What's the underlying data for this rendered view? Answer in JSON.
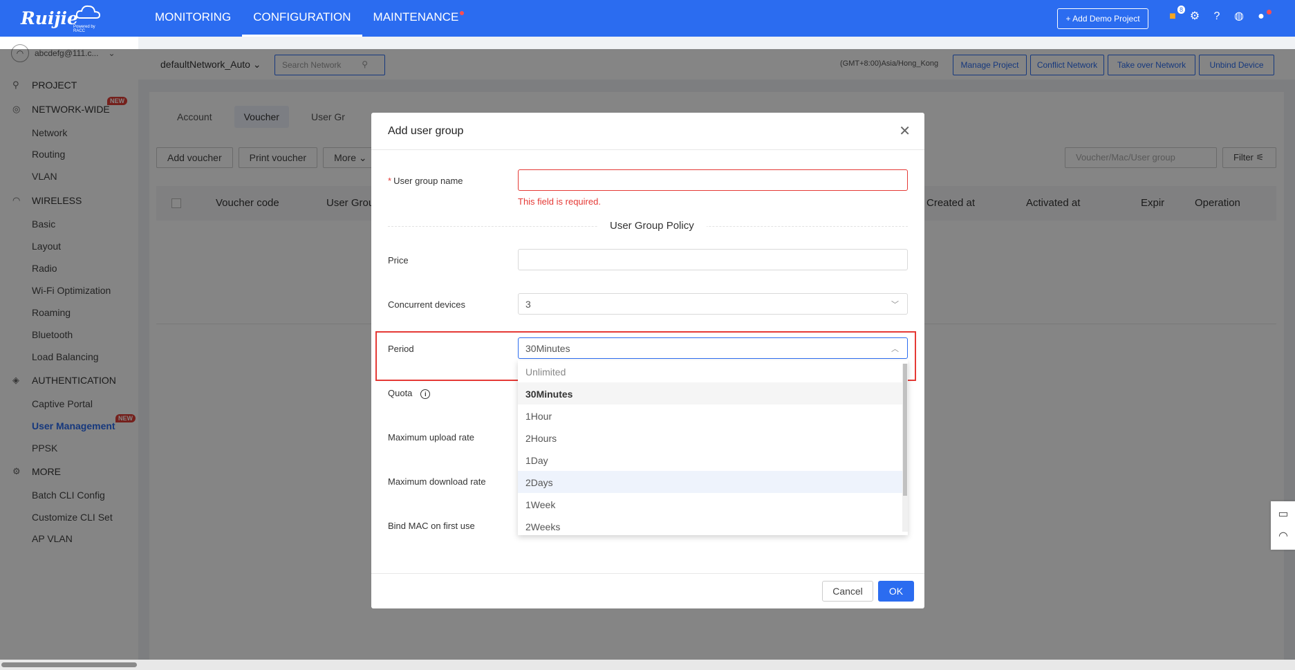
{
  "header": {
    "logo_text": "Ruijie",
    "logo_sub": "Powered by RACC",
    "nav": [
      "MONITORING",
      "CONFIGURATION",
      "MAINTENANCE"
    ],
    "add_demo_label": "+ Add Demo Project",
    "gift_badge": "8"
  },
  "sidebar": {
    "user": "abcdefg@111.c...",
    "project": "PROJECT",
    "network_wide": "NETWORK-WIDE",
    "new_tag": "NEW",
    "network": "Network",
    "routing": "Routing",
    "vlan": "VLAN",
    "wireless": "WIRELESS",
    "basic": "Basic",
    "layout": "Layout",
    "radio": "Radio",
    "wifi_opt": "Wi-Fi Optimization",
    "roaming": "Roaming",
    "bluetooth": "Bluetooth",
    "load_balancing": "Load Balancing",
    "authentication": "AUTHENTICATION",
    "captive_portal": "Captive Portal",
    "user_management": "User Management",
    "ppsk": "PPSK",
    "more": "MORE",
    "batch_cli": "Batch CLI Config",
    "customize_cli": "Customize CLI Set",
    "ap_vlan": "AP VLAN"
  },
  "subbar": {
    "network_select": "defaultNetwork_Auto",
    "search_placeholder": "Search Network",
    "timezone": "(GMT+8:00)Asia/Hong_Kong",
    "manage_project": "Manage Project",
    "conflict_network": "Conflict Network",
    "take_over": "Take over Network",
    "unbind": "Unbind Device"
  },
  "page": {
    "tabs": [
      "Account",
      "Voucher",
      "User Gr"
    ],
    "add_voucher": "Add voucher",
    "print_voucher": "Print voucher",
    "more": "More",
    "search_placeholder": "Voucher/Mac/User group",
    "filter": "Filter",
    "columns": [
      "Voucher code",
      "User Grou",
      "Created at",
      "Activated at",
      "Expir",
      "Operation"
    ]
  },
  "modal": {
    "title": "Add user group",
    "group_name_label": "User group name",
    "group_name_value": "",
    "error_text": "This field is required.",
    "policy_divider": "User Group Policy",
    "price_label": "Price",
    "price_value": "",
    "concurrent_label": "Concurrent devices",
    "concurrent_value": "3",
    "period_label": "Period",
    "period_value": "30Minutes",
    "quota_label": "Quota",
    "upload_label": "Maximum upload rate",
    "download_label": "Maximum download rate",
    "bind_mac_label": "Bind MAC on first use",
    "cancel": "Cancel",
    "ok": "OK"
  },
  "period_options": [
    "Unlimited",
    "30Minutes",
    "1Hour",
    "2Hours",
    "1Day",
    "2Days",
    "1Week",
    "2Weeks"
  ],
  "colors": {
    "brand_blue": "#2b6cf0",
    "error_red": "#e53935",
    "new_tag": "#e03e36"
  }
}
